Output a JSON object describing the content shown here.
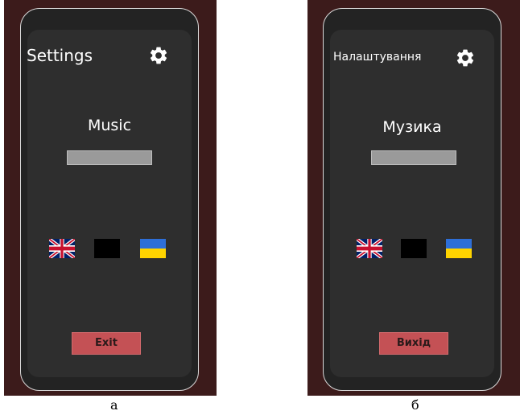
{
  "panels": [
    {
      "caption": "а",
      "title": "Settings",
      "settings_icon": "gear-icon",
      "music_label": "Music",
      "volume_slider": {
        "value": 1.0
      },
      "language_flags": [
        "uk-flag-icon",
        "black-flag-placeholder",
        "ukraine-flag-icon"
      ],
      "exit_label": "Exit"
    },
    {
      "caption": "б",
      "title": "Налаштування",
      "settings_icon": "gear-icon",
      "music_label": "Музика",
      "volume_slider": {
        "value": 1.0
      },
      "language_flags": [
        "uk-flag-icon",
        "black-flag-placeholder",
        "ukraine-flag-icon"
      ],
      "exit_label": "Вихід"
    }
  ],
  "colors": {
    "background_frame": "#3c1b1b",
    "phone_body": "#232323",
    "screen": "#2e2e2e",
    "slider": "#9a9a9a",
    "exit_button": "#c45155",
    "ua_blue": "#2e6fd8",
    "ua_yellow": "#ffd400"
  }
}
